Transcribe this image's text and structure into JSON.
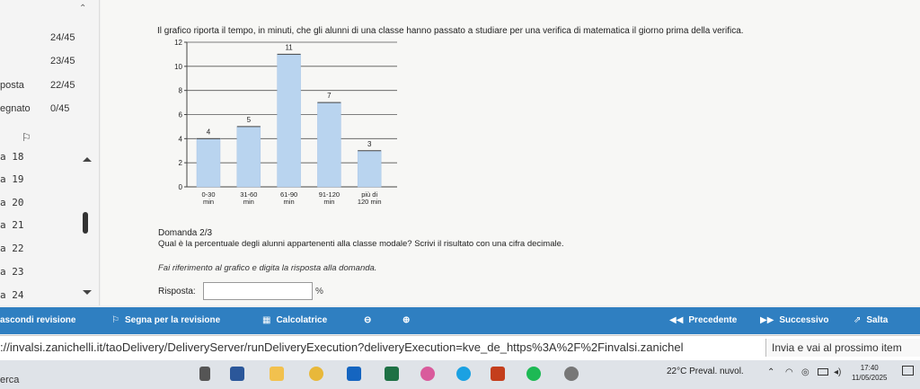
{
  "sidebar": {
    "rows": [
      {
        "name": "",
        "score": "24/45"
      },
      {
        "name": "",
        "score": "23/45"
      },
      {
        "name": "posta",
        "score": "22/45"
      },
      {
        "name": "egnato",
        "score": "0/45"
      }
    ],
    "questions": [
      "a 18",
      "a 19",
      "a 20",
      "a 21",
      "a 22",
      "a 23",
      "a 24"
    ]
  },
  "caption": "Il grafico riporta il tempo, in minuti, che gli alunni di una classe hanno passato a studiare per una verifica di matematica il giorno prima della verifica.",
  "chart_data": {
    "type": "bar",
    "categories": [
      "0-30 min",
      "31-60 min",
      "61-90 min",
      "91-120 min",
      "più di 120 min"
    ],
    "category_lines": [
      [
        "0-30",
        "min"
      ],
      [
        "31-60",
        "min"
      ],
      [
        "61-90",
        "min"
      ],
      [
        "91-120",
        "min"
      ],
      [
        "più di",
        "120 min"
      ]
    ],
    "values": [
      4,
      5,
      11,
      7,
      3
    ],
    "ylim": [
      0,
      12
    ],
    "yticks": [
      0,
      2,
      4,
      6,
      8,
      10,
      12
    ],
    "grid": true,
    "bar_color": "#b9d4ef"
  },
  "question": {
    "title": "Domanda 2/3",
    "text": "Qual è la percentuale degli alunni appartenenti alla classe modale? Scrivi il risultato con una cifra decimale.",
    "hint": "Fai riferimento al grafico e digita la risposta alla domanda.",
    "answer_label": "Risposta:",
    "answer_value": "",
    "unit": "%"
  },
  "toolbar": {
    "hide_review": "ascondi revisione",
    "mark_review": "Segna per la revisione",
    "calculator": "Calcolatrice",
    "previous": "Precedente",
    "next": "Successivo",
    "skip": "Salta"
  },
  "browser": {
    "url": "://invalsi.zanichelli.it/taoDelivery/DeliveryServer/runDeliveryExecution?deliveryExecution=kve_de_https%3A%2F%2Finvalsi.zanichel",
    "tip": "Invia e vai al prossimo item"
  },
  "taskbar": {
    "search": "erca",
    "weather_temp": "22°C",
    "weather_desc": "Preval. nuvol.",
    "time": "17:40",
    "date": "11/05/2025"
  },
  "colors": {
    "accent": "#2f7fc1"
  }
}
